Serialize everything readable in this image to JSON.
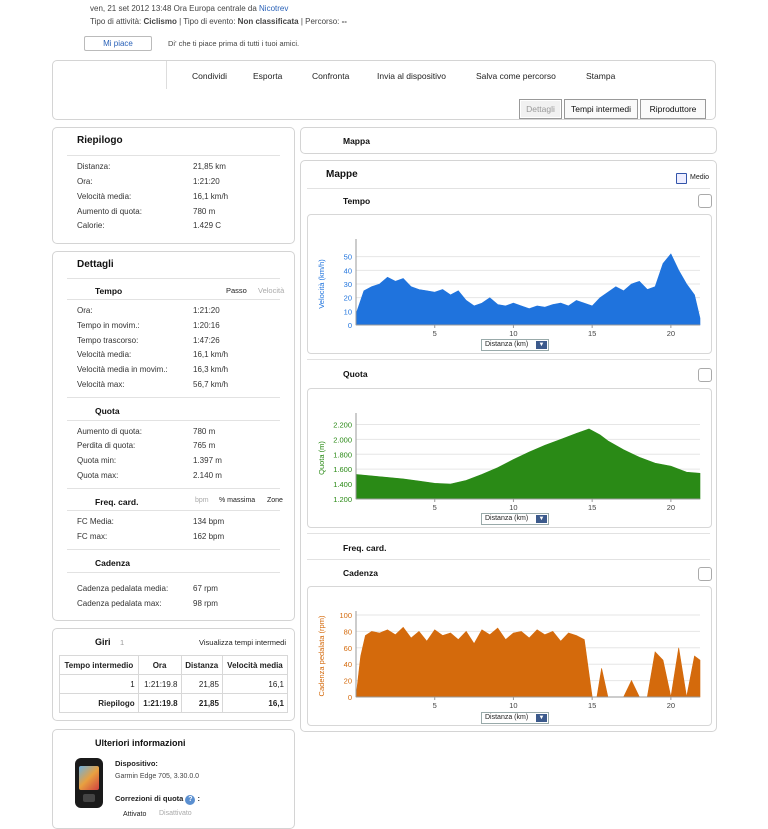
{
  "header": {
    "date_text": "ven, 21 set 2012 13:48 Ora Europa centrale da",
    "user": "Nicotrev",
    "type_prefix": "Tipo di attività:",
    "type_value": "Ciclismo",
    "event_prefix": "| Tipo di evento:",
    "event_value": "Non classificata",
    "route_prefix": "| Percorso:",
    "route_value": "--",
    "like_button": "Mi piace",
    "like_text": "Di' che ti piace prima di tutti i tuoi amici."
  },
  "toolbar": {
    "links": [
      "Condividi",
      "Esporta",
      "Confronta",
      "Invia al dispositivo",
      "Salva come percorso",
      "Stampa"
    ],
    "tabs": [
      "Dettagli",
      "Tempi intermedi",
      "Riproduttore"
    ]
  },
  "summary": {
    "title": "Riepilogo",
    "rows": [
      {
        "label": "Distanza:",
        "value": "21,85 km"
      },
      {
        "label": "Ora:",
        "value": "1:21:20"
      },
      {
        "label": "Velocità media:",
        "value": "16,1 km/h"
      },
      {
        "label": "Aumento di quota:",
        "value": "780 m"
      },
      {
        "label": "Calorie:",
        "value": "1.429 C"
      }
    ]
  },
  "details": {
    "title": "Dettagli",
    "time": {
      "title": "Tempo",
      "toggle_a": "Passo",
      "toggle_b": "Velocità",
      "rows": [
        {
          "label": "Ora:",
          "value": "1:21:20"
        },
        {
          "label": "Tempo in movim.:",
          "value": "1:20:16"
        },
        {
          "label": "Tempo trascorso:",
          "value": "1:47:26"
        },
        {
          "label": "Velocità media:",
          "value": "16,1 km/h"
        },
        {
          "label": "Velocità media in movim.:",
          "value": "16,3 km/h"
        },
        {
          "label": "Velocità max:",
          "value": "56,7 km/h"
        }
      ]
    },
    "elevation": {
      "title": "Quota",
      "rows": [
        {
          "label": "Aumento di quota:",
          "value": "780 m"
        },
        {
          "label": "Perdita di quota:",
          "value": "765 m"
        },
        {
          "label": "Quota min:",
          "value": "1.397 m"
        },
        {
          "label": "Quota max:",
          "value": "2.140 m"
        }
      ]
    },
    "heart": {
      "title": "Freq. card.",
      "toggle_a": "bpm",
      "toggle_b": "% massima",
      "toggle_c": "Zone",
      "rows": [
        {
          "label": "FC Media:",
          "value": "134 bpm"
        },
        {
          "label": "FC max:",
          "value": "162 bpm"
        }
      ]
    },
    "cadence": {
      "title": "Cadenza",
      "rows": [
        {
          "label": "Cadenza pedalata media:",
          "value": "67 rpm"
        },
        {
          "label": "Cadenza pedalata max:",
          "value": "98 rpm"
        }
      ]
    }
  },
  "laps": {
    "title": "Giri",
    "count": "1",
    "link": "Visualizza tempi intermedi",
    "headers": [
      "Tempo intermedio",
      "Ora",
      "Distanza",
      "Velocità media"
    ],
    "rows": [
      [
        "1",
        "1:21:19.8",
        "21,85",
        "16,1"
      ],
      [
        "Riepilogo",
        "1:21:19.8",
        "21,85",
        "16,1"
      ]
    ]
  },
  "more_info": {
    "title": "Ulteriori informazioni",
    "device_label": "Dispositivo:",
    "device_value": "Garmin Edge 705, 3.30.0.0",
    "elev_corr_label": "Correzioni di quota",
    "elev_corr_suffix": ":",
    "active": "Attivato",
    "inactive": "Disattivato"
  },
  "map": {
    "title": "Mappa"
  },
  "charts_panel": {
    "title": "Mappe",
    "average_label": "Medio",
    "dropdown_value": "Distanza (km)"
  },
  "chart_data": [
    {
      "type": "area",
      "title": "Tempo",
      "ylabel": "Velocità (km/h)",
      "xlabel": "Distanza (km)",
      "color": "#1f73dd",
      "xlim": [
        0,
        21.85
      ],
      "ylim": [
        0,
        60
      ],
      "xticks": [
        5,
        10,
        15,
        20
      ],
      "yticks": [
        0,
        10,
        20,
        30,
        40,
        50
      ],
      "x": [
        0,
        0.5,
        1,
        1.5,
        2,
        2.5,
        3,
        3.5,
        4,
        4.5,
        5,
        5.5,
        6,
        6.5,
        7,
        7.5,
        8,
        8.5,
        9,
        9.5,
        10,
        10.5,
        11,
        11.5,
        12,
        12.5,
        13,
        13.5,
        14,
        14.5,
        15,
        15.5,
        16,
        16.5,
        17,
        17.5,
        18,
        18.5,
        19,
        19.5,
        20,
        20.5,
        21,
        21.5,
        21.85
      ],
      "y": [
        8,
        25,
        28,
        30,
        35,
        32,
        34,
        28,
        26,
        25,
        24,
        26,
        22,
        25,
        18,
        14,
        16,
        20,
        15,
        14,
        16,
        14,
        12,
        14,
        13,
        15,
        16,
        14,
        18,
        16,
        14,
        20,
        24,
        28,
        25,
        30,
        32,
        26,
        28,
        45,
        52,
        40,
        30,
        22,
        5
      ]
    },
    {
      "type": "area",
      "title": "Quota",
      "ylabel": "Quota (m)",
      "xlabel": "Distanza (km)",
      "color": "#2a8a16",
      "xlim": [
        0,
        21.85
      ],
      "ylim": [
        1200,
        2300
      ],
      "xticks": [
        5,
        10,
        15,
        20
      ],
      "yticks": [
        1200,
        1400,
        1600,
        1800,
        2000,
        2200
      ],
      "ytick_labels": [
        "1.200",
        "1.400",
        "1.600",
        "1.800",
        "2.000",
        "2.200"
      ],
      "x": [
        0,
        1,
        2,
        3,
        4,
        5,
        6,
        7,
        8,
        9,
        10,
        11,
        12,
        13,
        14,
        14.8,
        15.5,
        16,
        17,
        18,
        19,
        20,
        21,
        21.85
      ],
      "y": [
        1530,
        1510,
        1490,
        1470,
        1440,
        1410,
        1400,
        1450,
        1530,
        1620,
        1730,
        1830,
        1920,
        2000,
        2080,
        2140,
        2060,
        1980,
        1860,
        1760,
        1680,
        1640,
        1560,
        1545
      ]
    },
    {
      "type": "area",
      "title": "Cadenza",
      "ylabel": "Cadenza pedalata (rpm)",
      "xlabel": "Distanza (km)",
      "color": "#d46a0c",
      "xlim": [
        0,
        21.85
      ],
      "ylim": [
        0,
        100
      ],
      "xticks": [
        5,
        10,
        15,
        20
      ],
      "yticks": [
        0,
        20,
        40,
        60,
        80,
        100
      ],
      "x": [
        0,
        0.3,
        0.6,
        1,
        1.5,
        2,
        2.5,
        3,
        3.5,
        4,
        4.5,
        5,
        5.5,
        6,
        6.5,
        7,
        7.5,
        8,
        8.5,
        9,
        9.5,
        10,
        10.5,
        11,
        11.5,
        12,
        12.5,
        13,
        13.5,
        14,
        14.5,
        15,
        15.3,
        15.6,
        16,
        16.5,
        17,
        17.5,
        18,
        18.5,
        19,
        19.5,
        20,
        20.5,
        21,
        21.5,
        21.85
      ],
      "y": [
        0,
        50,
        75,
        80,
        78,
        82,
        76,
        85,
        72,
        80,
        68,
        82,
        75,
        78,
        70,
        80,
        65,
        82,
        76,
        84,
        70,
        78,
        80,
        72,
        82,
        76,
        80,
        68,
        78,
        75,
        70,
        0,
        0,
        35,
        0,
        0,
        0,
        20,
        0,
        0,
        55,
        45,
        0,
        60,
        0,
        50,
        45
      ]
    }
  ]
}
